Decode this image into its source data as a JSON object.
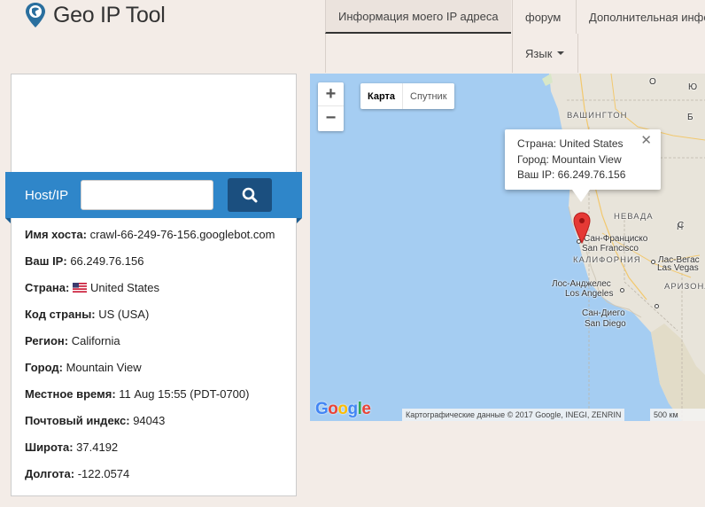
{
  "logo": {
    "geo": "Geo",
    "ip": "IP",
    "tool": "Tool"
  },
  "nav": {
    "my_ip": "Информация моего IP адреса",
    "forum": "форум",
    "more": "Дополнительная информация",
    "language": "Язык"
  },
  "search": {
    "label": "Host/IP",
    "value": "",
    "placeholder": ""
  },
  "info": [
    {
      "key": "Имя хоста:",
      "value": "crawl-66-249-76-156.googlebot.com"
    },
    {
      "key": "Ваш IP:",
      "value": "66.249.76.156"
    },
    {
      "key": "Страна:",
      "value": "United States"
    },
    {
      "key": "Код страны:",
      "value": "US (USA)"
    },
    {
      "key": "Регион:",
      "value": "California"
    },
    {
      "key": "Город:",
      "value": "Mountain View"
    },
    {
      "key": "Местное время:",
      "value": "11 Aug 15:55 (PDT-0700)"
    },
    {
      "key": "Почтовый индекс:",
      "value": "94043"
    },
    {
      "key": "Широта:",
      "value": "37.4192"
    },
    {
      "key": "Долгота:",
      "value": "-122.0574"
    }
  ],
  "map": {
    "zoom_in": "+",
    "zoom_out": "−",
    "type_map": "Карта",
    "type_satellite": "Спутник",
    "popup": {
      "country": "Страна: United States",
      "city": "Город: Mountain View",
      "ip": "Ваш IP: 66.249.76.156",
      "close": "✕"
    },
    "labels": {
      "washington": "ВАШИНГТОН",
      "nevada": "НЕВАДА",
      "california": "КАЛИФОРНИЯ",
      "arizona": "АРИЗОНА",
      "sf_ru": "Сан-Франциско",
      "sf_en": "San Francisco",
      "la_ru": "Лос-Анджелес",
      "la_en": "Los Angeles",
      "sd_ru": "Сан-Диего",
      "sd_en": "San Diego",
      "lv_ru": "Лас-Вегас",
      "lv_en": "Las Vegas",
      "o": "О",
      "u": "Ю",
      "b": "Б",
      "sw": "Н",
      "ari_partial": "С"
    },
    "attribution": "Картографические данные © 2017 Google, INEGI, ZENRIN",
    "scale": "500 км",
    "google": [
      "G",
      "o",
      "o",
      "g",
      "l",
      "e"
    ]
  },
  "colors": {
    "accent_blue": "#2f86c9",
    "button_dark": "#1b4f7f",
    "water": "#a5cdf2",
    "land": "#e8e4da",
    "marker": "#e53935"
  }
}
